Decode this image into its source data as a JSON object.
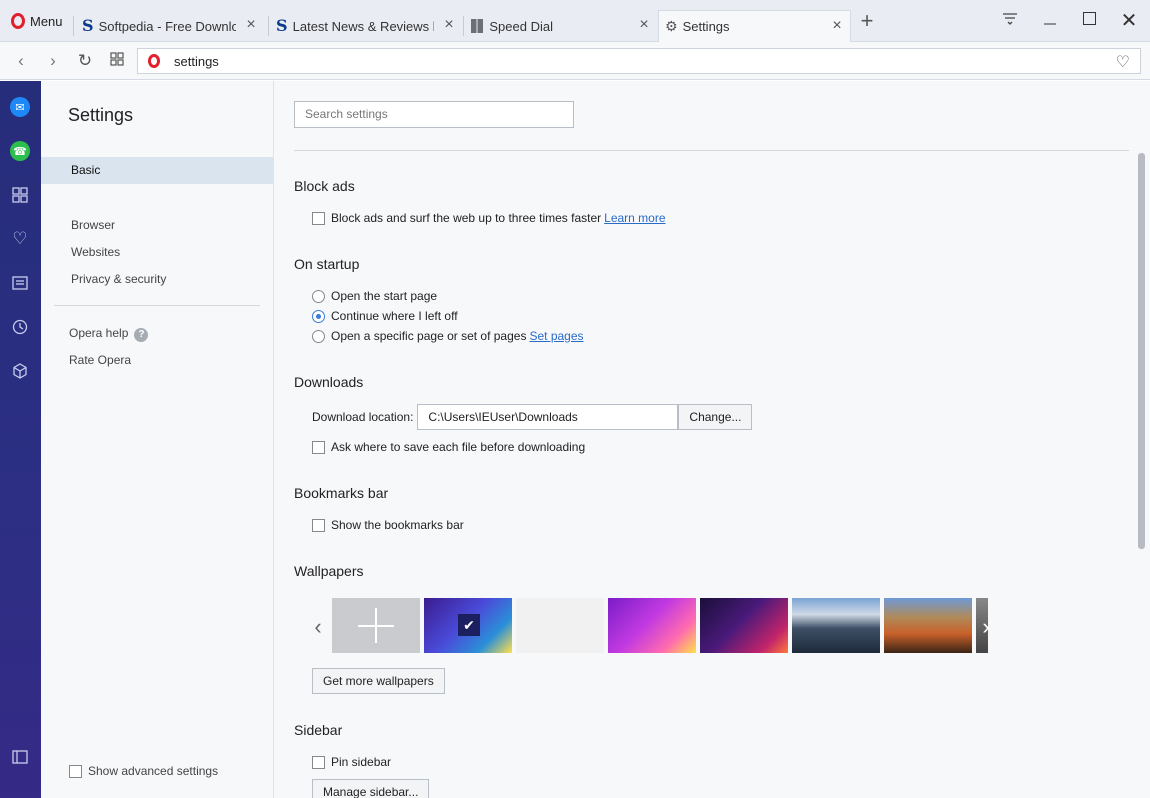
{
  "browser": {
    "menu_label": "Menu",
    "tabs": [
      {
        "title": "Softpedia - Free Downloads"
      },
      {
        "title": "Latest News & Reviews by Softpedia"
      },
      {
        "title": "Speed Dial"
      },
      {
        "title": "Settings"
      }
    ],
    "address": "settings"
  },
  "nav": {
    "title": "Settings",
    "basic": "Basic",
    "browser": "Browser",
    "websites": "Websites",
    "privacy": "Privacy & security",
    "help": "Opera help",
    "rate": "Rate Opera",
    "advanced": "Show advanced settings"
  },
  "search": {
    "placeholder": "Search settings"
  },
  "block_ads": {
    "title": "Block ads",
    "option": "Block ads and surf the web up to three times faster",
    "link": "Learn more"
  },
  "startup": {
    "title": "On startup",
    "opt1": "Open the start page",
    "opt2": "Continue where I left off",
    "opt3": "Open a specific page or set of pages",
    "link": "Set pages"
  },
  "downloads": {
    "title": "Downloads",
    "location_label": "Download location:",
    "location_value": "C:\\Users\\IEUser\\Downloads",
    "change": "Change...",
    "ask": "Ask where to save each file before downloading"
  },
  "bookmarks": {
    "title": "Bookmarks bar",
    "option": "Show the bookmarks bar"
  },
  "wallpapers": {
    "title": "Wallpapers",
    "more": "Get more wallpapers"
  },
  "sidebar_sec": {
    "title": "Sidebar",
    "pin": "Pin sidebar",
    "manage": "Manage sidebar..."
  },
  "colors": {
    "accent": "#3c7bd6",
    "sidebar": "#2c2f84",
    "opera_red": "#e0202d"
  }
}
